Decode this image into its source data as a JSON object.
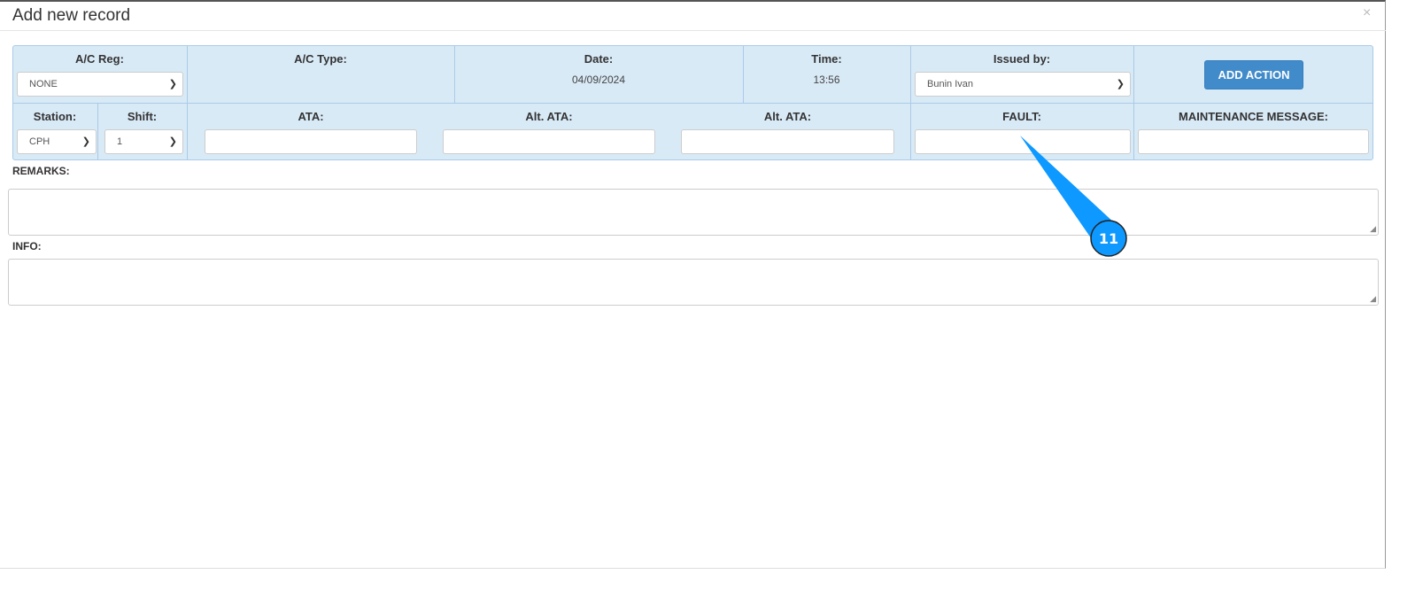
{
  "modal": {
    "title": "Add new record",
    "close": "×"
  },
  "header": {
    "ac_reg": {
      "label": "A/C Reg:",
      "value": "NONE"
    },
    "ac_type": {
      "label": "A/C Type:"
    },
    "date": {
      "label": "Date:",
      "value": "04/09/2024"
    },
    "time": {
      "label": "Time:",
      "value": "13:56"
    },
    "issued_by": {
      "label": "Issued by:",
      "value": "Bunin Ivan"
    },
    "add_action": "ADD ACTION",
    "station": {
      "label": "Station:",
      "value": "CPH"
    },
    "shift": {
      "label": "Shift:",
      "value": "1"
    },
    "ata": {
      "label": "ATA:",
      "value": ""
    },
    "alt_ata_1": {
      "label": "Alt. ATA:",
      "value": ""
    },
    "alt_ata_2": {
      "label": "Alt. ATA:",
      "value": ""
    },
    "fault": {
      "label": "FAULT:",
      "value": ""
    },
    "maintenance_message": {
      "label": "MAINTENANCE MESSAGE:",
      "value": ""
    }
  },
  "remarks": {
    "label": "REMARKS:",
    "value": ""
  },
  "info": {
    "label": "INFO:",
    "value": ""
  },
  "callout": {
    "number": "11",
    "color": "#0d99ff"
  }
}
